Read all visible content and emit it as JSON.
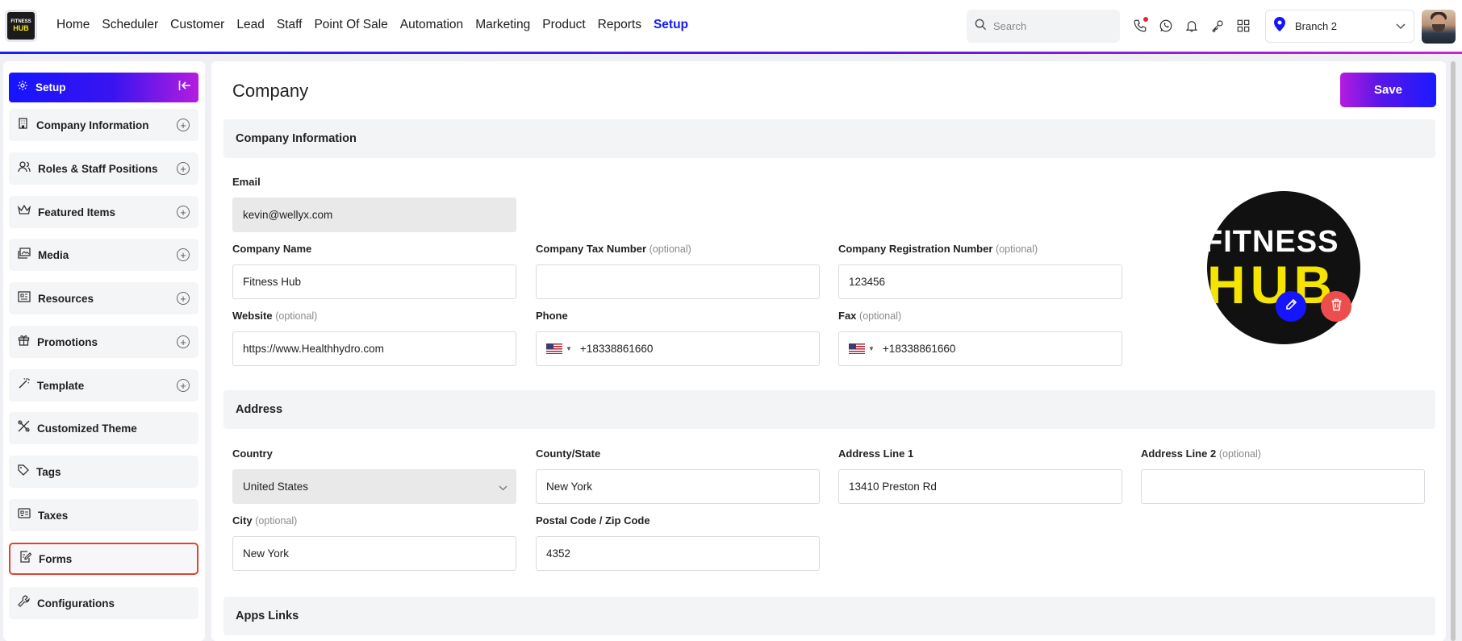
{
  "nav": {
    "items": [
      "Home",
      "Scheduler",
      "Customer",
      "Lead",
      "Staff",
      "Point Of Sale",
      "Automation",
      "Marketing",
      "Product",
      "Reports",
      "Setup"
    ],
    "active": "Setup",
    "logo_line1": "FITNESS",
    "logo_line2": "HUB"
  },
  "search": {
    "placeholder": "Search"
  },
  "branch": {
    "label": "Branch 2"
  },
  "sidebar": {
    "header": "Setup",
    "items": [
      {
        "label": "Company Information",
        "icon": "building-icon",
        "expandable": true
      },
      {
        "label": "Roles & Staff Positions",
        "icon": "users-icon",
        "expandable": true
      },
      {
        "label": "Featured Items",
        "icon": "crown-icon",
        "expandable": true
      },
      {
        "label": "Media",
        "icon": "media-icon",
        "expandable": true
      },
      {
        "label": "Resources",
        "icon": "resources-icon",
        "expandable": true
      },
      {
        "label": "Promotions",
        "icon": "gift-icon",
        "expandable": true
      },
      {
        "label": "Template",
        "icon": "magic-wand-icon",
        "expandable": true
      },
      {
        "label": "Customized Theme",
        "icon": "theme-icon",
        "expandable": false
      },
      {
        "label": "Tags",
        "icon": "tag-icon",
        "expandable": false
      },
      {
        "label": "Taxes",
        "icon": "taxes-icon",
        "expandable": false
      },
      {
        "label": "Forms",
        "icon": "form-icon",
        "expandable": false,
        "selected": true
      },
      {
        "label": "Configurations",
        "icon": "wrench-icon",
        "expandable": false
      }
    ]
  },
  "page": {
    "title": "Company",
    "save_label": "Save"
  },
  "sections": {
    "company_info": "Company Information",
    "address": "Address",
    "apps_links": "Apps Links"
  },
  "fields": {
    "email": {
      "label": "Email",
      "value": "kevin@wellyx.com"
    },
    "company_name": {
      "label": "Company Name",
      "value": "Fitness Hub"
    },
    "tax_number": {
      "label": "Company Tax Number",
      "optional": "(optional)",
      "value": ""
    },
    "registration_number": {
      "label": "Company Registration Number",
      "optional": "(optional)",
      "value": "123456"
    },
    "website": {
      "label": "Website",
      "optional": "(optional)",
      "value": "https://www.Healthhydro.com"
    },
    "phone": {
      "label": "Phone",
      "value": "+18338861660"
    },
    "fax": {
      "label": "Fax",
      "optional": "(optional)",
      "value": "+18338861660"
    },
    "country": {
      "label": "Country",
      "value": "United States"
    },
    "state": {
      "label": "County/State",
      "value": "New York"
    },
    "address1": {
      "label": "Address Line 1",
      "value": "13410 Preston Rd"
    },
    "address2": {
      "label": "Address Line 2",
      "optional": "(optional)",
      "value": ""
    },
    "city": {
      "label": "City",
      "optional": "(optional)",
      "value": "New York"
    },
    "postal": {
      "label": "Postal Code / Zip Code",
      "value": "4352"
    }
  },
  "company_logo": {
    "line1": "FITNESS",
    "line2": "HUB"
  },
  "colors": {
    "accent": "#1515ff",
    "gradient_end": "#b51ce0",
    "delete": "#ee4d4d",
    "selected_outline": "#e0442f"
  }
}
